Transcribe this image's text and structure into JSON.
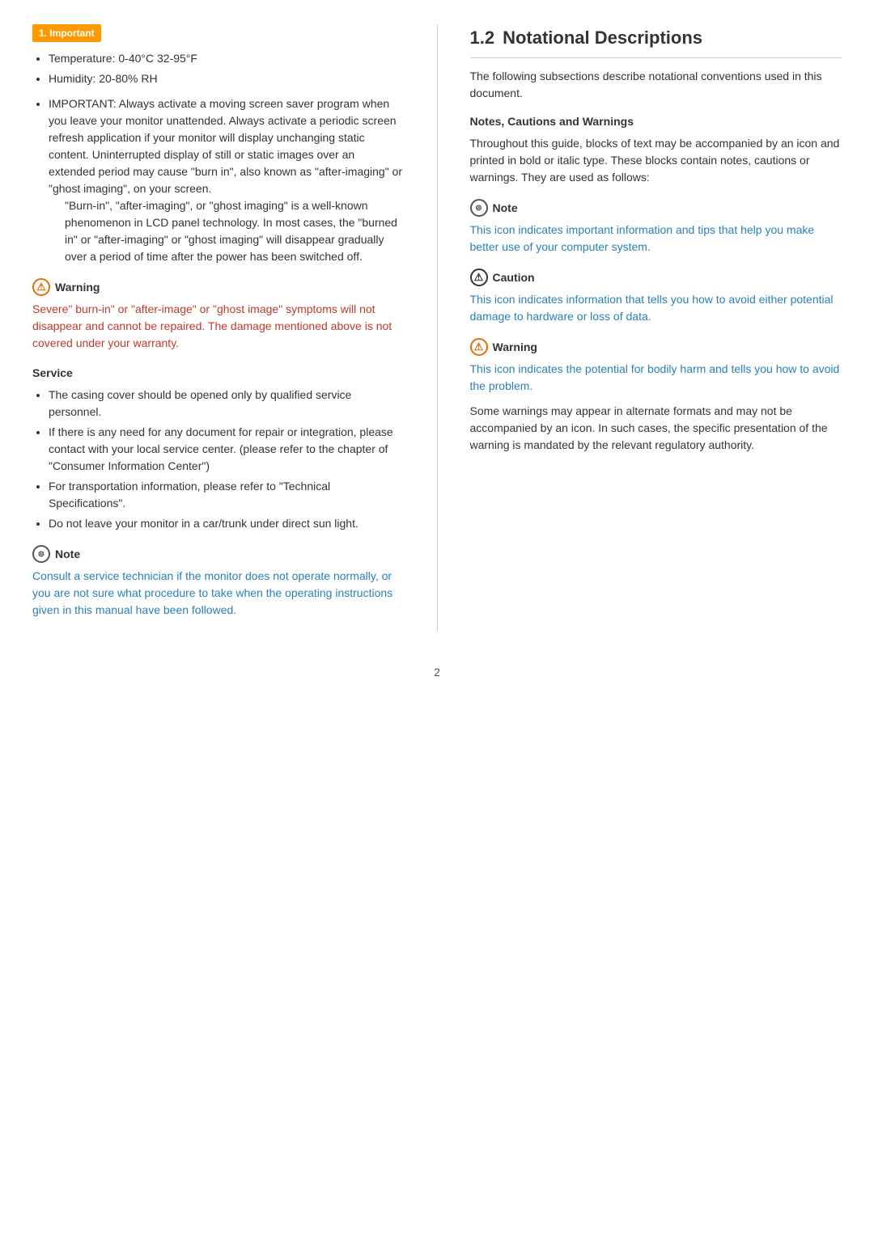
{
  "important_tag": "1. Important",
  "left_col": {
    "bullet_items": [
      "Temperature: 0-40°C 32-95°F",
      "Humidity: 20-80% RH"
    ],
    "important_text": "IMPORTANT: Always activate a moving screen saver program when you leave your monitor unattended. Always activate a periodic screen refresh application if your monitor will display unchanging static content. Uninterrupted display of still or static images over an extended period may cause \"burn in\", also known as \"after-imaging\" or \"ghost imaging\", on your screen.",
    "burn_in_note": "\"Burn-in\", \"after-imaging\", or \"ghost imaging\" is a well-known phenomenon in LCD panel technology. In most cases, the \"burned in\" or \"after-imaging\" or \"ghost imaging\" will disappear gradually over a period of time after the power has been switched off.",
    "warning1": {
      "label": "Warning",
      "text": "Severe\" burn-in\" or \"after-image\" or \"ghost image\" symptoms will not disappear and cannot be repaired. The damage mentioned above is not covered under your warranty."
    },
    "service_heading": "Service",
    "service_items": [
      "The casing cover should be opened only by qualified service personnel.",
      "If there is any need for any document for repair or integration, please contact with your local service center. (please refer to the chapter of \"Consumer Information Center\")",
      "For transportation information, please refer to \"Technical Specifications\".",
      "Do not leave your monitor in a car/trunk under direct sun light."
    ],
    "note1": {
      "label": "Note",
      "text": "Consult a service technician if the monitor does not operate normally, or you are not sure what procedure to take when the operating instructions given in this manual have been followed."
    }
  },
  "right_col": {
    "section_num": "1.2",
    "section_title": "Notational Descriptions",
    "intro": "The following subsections describe notational conventions used in this document.",
    "subheading": "Notes, Cautions and Warnings",
    "subheading_text": "Throughout this guide, blocks of text may be accompanied by an icon and printed in bold or italic type. These blocks contain notes, cautions or warnings. They are used as follows:",
    "note1": {
      "label": "Note",
      "text": "This icon indicates important information and tips that help you make better use of your computer system."
    },
    "caution1": {
      "label": "Caution",
      "text": "This icon indicates information that tells you how to avoid either potential damage to hardware or loss of data."
    },
    "warning1": {
      "label": "Warning",
      "text1": "This icon indicates the potential for bodily harm and tells you how to avoid the problem.",
      "text2": "Some warnings may appear in alternate formats and may not be accompanied by an icon. In such cases, the specific presentation of the warning is mandated by the relevant regulatory authority."
    }
  },
  "page_num": "2"
}
